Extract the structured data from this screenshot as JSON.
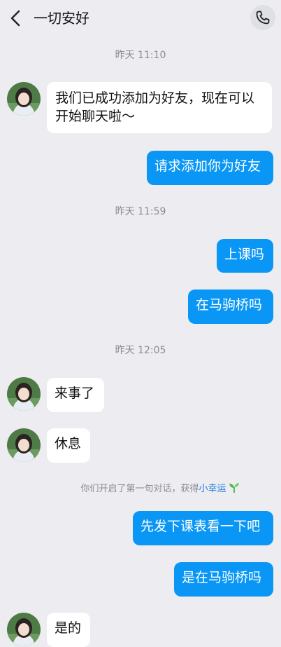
{
  "header": {
    "title": "一切安好"
  },
  "timestamps": [
    "昨天 11:10",
    "昨天 11:59",
    "昨天 12:05"
  ],
  "messages": [
    {
      "text": "我们已成功添加为好友，现在可以开始聊天啦～",
      "side": "in"
    },
    {
      "text": "请求添加你为好友",
      "side": "out"
    },
    {
      "text": "上课吗",
      "side": "out"
    },
    {
      "text": "在马驹桥吗",
      "side": "out"
    },
    {
      "text": "来事了",
      "side": "in"
    },
    {
      "text": "休息",
      "side": "in"
    },
    {
      "text": "先发下课表看一下吧",
      "side": "out"
    },
    {
      "text": "是在马驹桥吗",
      "side": "out"
    },
    {
      "text": "是的",
      "side": "in"
    }
  ],
  "system_notice": {
    "text": "你们开启了第一句对话，获得",
    "link": "小幸运",
    "icon": "sprout-icon"
  },
  "icons": {
    "back": "chevron-left-icon",
    "call": "phone-icon"
  },
  "colors": {
    "background": "#ececf1",
    "outgoing_bubble": "#0996f5",
    "incoming_bubble": "#ffffff",
    "timestamp_text": "#8b8c93",
    "link": "#1e7ce3",
    "sprout": "#4cb84a"
  }
}
